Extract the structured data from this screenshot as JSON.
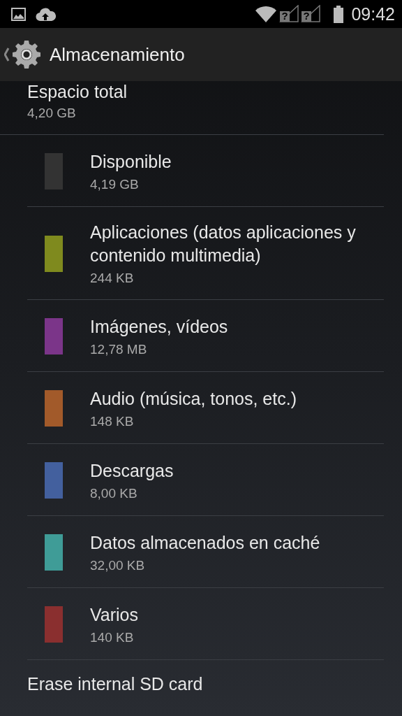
{
  "status_bar": {
    "sim_marks": [
      "?",
      "?"
    ],
    "time": "09:42"
  },
  "action_bar": {
    "title": "Almacenamiento"
  },
  "total": {
    "title": "Espacio total",
    "value": "4,20 GB"
  },
  "categories": [
    {
      "name": "Disponible",
      "size": "4,19 GB",
      "color": "#333333"
    },
    {
      "name": "Aplicaciones (datos aplicaciones y contenido multimedia)",
      "size": "244 KB",
      "color": "#7f8a1e"
    },
    {
      "name": "Imágenes, vídeos",
      "size": "12,78 MB",
      "color": "#7b3589"
    },
    {
      "name": "Audio (música, tonos, etc.)",
      "size": "148 KB",
      "color": "#a25a2a"
    },
    {
      "name": "Descargas",
      "size": "8,00 KB",
      "color": "#43609e"
    },
    {
      "name": "Datos almacenados en caché",
      "size": "32,00 KB",
      "color": "#3f9c97"
    },
    {
      "name": "Varios",
      "size": "140 KB",
      "color": "#8a2f2f"
    }
  ],
  "actions": [
    "Erase internal SD card"
  ]
}
